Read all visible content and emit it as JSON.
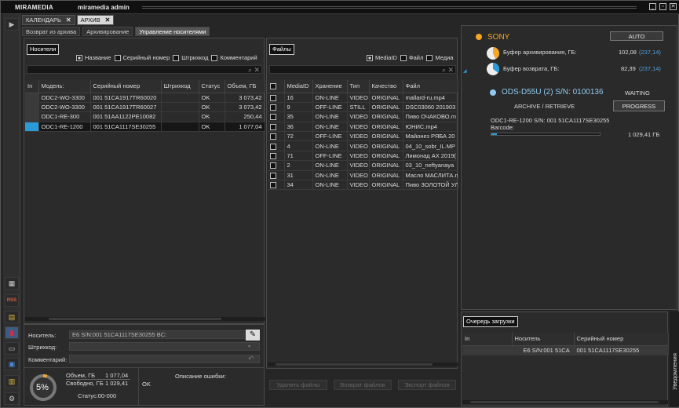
{
  "title": {
    "app": "MIRAMEDIA",
    "user": "miramedia admin"
  },
  "tabs": [
    {
      "label": "КАЛЕНДАРЬ",
      "close": "✕"
    },
    {
      "label": "АРХИВ",
      "close": "✕"
    }
  ],
  "subtabs": [
    "Возврат из архива",
    "Архивирование",
    "Управление носителями"
  ],
  "sidebar": {
    "rss": "RSS"
  },
  "media": {
    "header": "Носители",
    "options": [
      {
        "label": "Название",
        "checked": true
      },
      {
        "label": "Серийный номер",
        "checked": false
      },
      {
        "label": "Штрихкод",
        "checked": false
      },
      {
        "label": "Комментарий",
        "checked": false
      }
    ],
    "columns": [
      "In",
      "Модель:",
      "Серийный номер",
      "Штрихкод",
      "Статус",
      "Объем, ГБ"
    ],
    "rows": [
      {
        "model": "ODC2-WO-3300",
        "serial": "001 51CA1917TR60020",
        "barcode": "",
        "status": "OK",
        "size": "3 073,42",
        "sel": false,
        "in": false
      },
      {
        "model": "ODC2-WO-3300",
        "serial": "001 51CA1917TR60027",
        "barcode": "",
        "status": "OK",
        "size": "3 073,42",
        "sel": false,
        "in": false
      },
      {
        "model": "ODC1-RE-300",
        "serial": "001 51AA1122PE10082",
        "barcode": "",
        "status": "OK",
        "size": "250,44",
        "sel": false,
        "in": false
      },
      {
        "model": "ODC1-RE-1200",
        "serial": "001 51CA1117SE30255",
        "barcode": "",
        "status": "OK",
        "size": "1 077,04",
        "sel": true,
        "in": true
      }
    ]
  },
  "details": {
    "carrier_label": "Носитель:",
    "carrier_value": "E6 S/N:001 51CA1117SE30255 BC:",
    "barcode_label": "Штрихкод:",
    "comment_label": "Комментарий:",
    "percent": "5%",
    "percent_value": 5,
    "volume_label": "Объем, ГБ",
    "volume_value": "1 077,04",
    "free_label": "Свободно, ГБ",
    "free_value": "1 029,41",
    "status": "Статус:00-000",
    "error_label": "Описание ошибки:",
    "error_value": "OK"
  },
  "files": {
    "header": "Файлы",
    "options": [
      {
        "label": "MediaID",
        "checked": true
      },
      {
        "label": "Файл",
        "checked": false
      },
      {
        "label": "Медиа",
        "checked": false
      }
    ],
    "columns": [
      "",
      "MediaID",
      "Хранение",
      "Тип",
      "Качество",
      "Файл"
    ],
    "rows": [
      {
        "id": "16",
        "storage": "ON-LINE",
        "type": "VIDEO",
        "quality": "ORIGINAL",
        "file": "mallard-ru.mp4"
      },
      {
        "id": "9",
        "storage": "OFF-LINE",
        "type": "STILL",
        "quality": "ORIGINAL",
        "file": "DSC03060 201903"
      },
      {
        "id": "35",
        "storage": "ON-LINE",
        "type": "VIDEO",
        "quality": "ORIGINAL",
        "file": "Пиво ОЧАКОВО.m"
      },
      {
        "id": "36",
        "storage": "ON-LINE",
        "type": "VIDEO",
        "quality": "ORIGINAL",
        "file": "ЮНИС.mp4"
      },
      {
        "id": "72",
        "storage": "OFF-LINE",
        "type": "VIDEO",
        "quality": "ORIGINAL",
        "file": "Майонез РЯБА 20"
      },
      {
        "id": "4",
        "storage": "ON-LINE",
        "type": "VIDEO",
        "quality": "ORIGINAL",
        "file": "04_10_sobr_IL.MP"
      },
      {
        "id": "71",
        "storage": "OFF-LINE",
        "type": "VIDEO",
        "quality": "ORIGINAL",
        "file": "Лимонад АХ 2019("
      },
      {
        "id": "2",
        "storage": "ON-LINE",
        "type": "VIDEO",
        "quality": "ORIGINAL",
        "file": "03_10_neftyanaya"
      },
      {
        "id": "31",
        "storage": "ON-LINE",
        "type": "VIDEO",
        "quality": "ORIGINAL",
        "file": "Масло МАСЛИТА.n"
      },
      {
        "id": "34",
        "storage": "ON-LINE",
        "type": "VIDEO",
        "quality": "ORIGINAL",
        "file": "Пиво ЗОЛОТОЙ УЛ"
      }
    ],
    "buttons": [
      "Удалить файлы",
      "Возврат файлов",
      "Экспорт файлов"
    ]
  },
  "device": {
    "brand": "SONY",
    "auto": "AUTO",
    "buf_archive_label": "Буфер архивирования, ГБ:",
    "buf_archive_used": "102,08",
    "buf_archive_total": "(237,14)",
    "buf_archive_fraction": 0.43,
    "buf_return_label": "Буфер возврата, ГБ:",
    "buf_return_used": "82,39",
    "buf_return_total": "(237,14)",
    "buf_return_fraction": 0.35,
    "drive_name": "ODS-D55U (2) S/N: 0100136",
    "drive_state": "WAITING",
    "mode": "ARCHIVE / RETRIEVE",
    "progress_btn": "PROGRESS",
    "disc": "ODC1-RE-1200 S/N: 001 51CA1117SE30255",
    "barcode_label": "Barcode:",
    "disc_size": "1 029,41 ГБ",
    "disc_fraction": 0.05
  },
  "queue": {
    "header": "Очередь загрузки",
    "columns": [
      "In",
      "Носитель",
      "Серийный номер"
    ],
    "rows": [
      {
        "in": "",
        "carrier": "E6 S/N:001 51CA",
        "serial": "001 51CA1117SE30255"
      }
    ]
  },
  "notifications": "Уведомления",
  "colors": {
    "accent": "#2b9bd7",
    "orange": "#f5a623",
    "bg": "#262626"
  }
}
